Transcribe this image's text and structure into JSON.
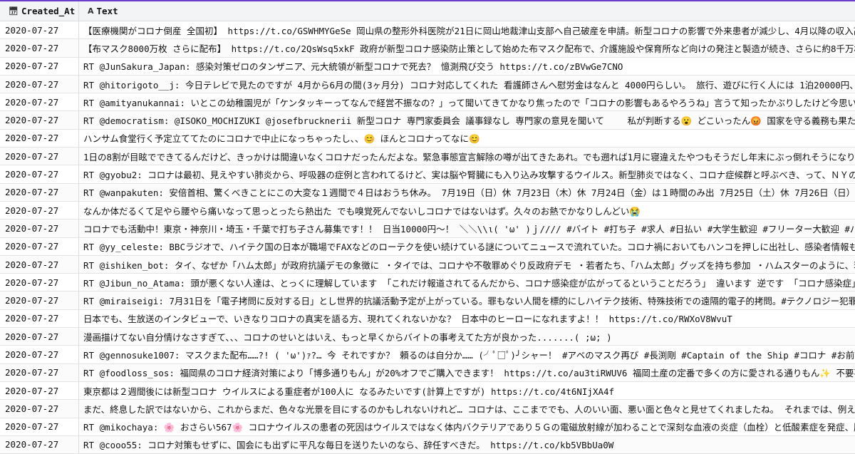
{
  "columns": [
    {
      "label": "Created_At",
      "icon": "calendar-icon"
    },
    {
      "label": "Text",
      "icon": "text-type-icon"
    }
  ],
  "rows": [
    {
      "date": "2020-07-27",
      "text": "【医療機関がコロナ倒産 全国初】 https://t.co/GSWHMYGeSe 岡山県の整形外科医院が21日に岡山地裁津山支部へ自己破産を申請。新型コロナの影響で外来患者が減少し、4月以降の収入高は前年同"
    },
    {
      "date": "2020-07-27",
      "text": "【布マスク8000万枚 さらに配布】 https://t.co/2QsWsq5xkF 政府が新型コロナ感染防止策として始めた布マスク配布で、介護施設や保育所など向けの発注と製造が続き、さらに約8千万枚を配る計画"
    },
    {
      "date": "2020-07-27",
      "text": "RT @JunSakura_Japan: 感染対策ゼロのタンザニア、元大統領が新型コロナで死去？ 憶測飛び交う https://t.co/zBVwGe7CNO"
    },
    {
      "date": "2020-07-27",
      "text": "RT @hitorigoto__j: 今日テレビで見たのですが 4月から6月の間(3ヶ月分) コロナ対応してくれた 看護師さんへ慰労金はなんと 4000円らしい。 旅行、遊びに行く人には 1泊20000円、日帰り1万"
    },
    {
      "date": "2020-07-27",
      "text": "RT @amityanukannai: いとこの幼稚園児が「ケンタッキーってなんで経営不振なの？」って聞いてきてかなり焦ったので「コロナの影響もあるやろうね」言うて知ったかぶりしたけど今思い返せば"
    },
    {
      "date": "2020-07-27",
      "text": "RT @democratism: @ISOKO_MOCHIZUKI @josefbrucknerii 新型コロナ 専門家委員会 議事録なし 専門家の意見を聞いて 　　私が判断する😮 どこいったん😡 国家を守る義務も果たさん奴は"
    },
    {
      "date": "2020-07-27",
      "text": "ハンサム食堂行く予定立ててたのにコロナで中止になっちゃったし、、😊 ほんとコロナってなに😊"
    },
    {
      "date": "2020-07-27",
      "text": "1日の8割が目眩でできてるんだけど、きっかけは間違いなくコロナだったんだよな。緊急事態宣言解除の噂が出てきたあれ。でも遡れば1月に寝違えたやつもそうだし年末にぶっ倒れそうになりながら生"
    },
    {
      "date": "2020-07-27",
      "text": "RT @gyobu2: コロナは最初、見えやすい肺炎から、呼吸器の症例と言われてるけど、実は脳や腎臓にも入り込み攻撃するウイルス。新型肺炎ではなく、コロナ症候群と呼ぶべき、って、ＮＹの医師が。"
    },
    {
      "date": "2020-07-27",
      "text": "RT @wanpakuten: 安倍首相、驚くべきことにこの大変な１週間で４日はおうち休み。 7月19日（日）休 7月23日（木）休 7月24日（金）は１時間のみ出 7月25日（土）休 7月26日（日）休 「全力"
    },
    {
      "date": "2020-07-27",
      "text": "なんか体だるくて足やら腰やら痛いなって思っとったら熱出た でも嗅覚死んでないしコロナではないはず。久々のお熱でかなりしんどい😭"
    },
    {
      "date": "2020-07-27",
      "text": "コロナでも活動中！東京・神奈川・埼玉・千葉で打ち子さん募集です！！ 日当10000円〜！ ＼＼\\\\ι( 'ω' )ｊ//// #バイト #打ち子 #求人 #日払い #大学生歓迎 #フリーター大歓迎 #パ"
    },
    {
      "date": "2020-07-27",
      "text": "RT @yy_celeste: BBCラジオで、ハイテク国の日本が職場でFAXなどのローテクを使い続けている謎についてニュースで流れていた。コロナ禍においてもハンコを押しに出社し、感染者情報も手書きで"
    },
    {
      "date": "2020-07-27",
      "text": "RT @ishiken_bot: タイ、なぜか「ハム太郎」が政府抗議デモの象徴に ・タイでは、コロナや不敬罪めぐり反政府デモ ・若者たち、「ハム太郎」グッズを持ち参加 ・ハムスターのように、若者たち"
    },
    {
      "date": "2020-07-27",
      "text": "RT @Jibun_no_Atama: 頭が悪くない人達は、とっくに理解しています 「これだけ報道されてるんだから、コロナ感染症が広がってるということだろう」 違います 逆です 「コロナ感染症」を広げた"
    },
    {
      "date": "2020-07-27",
      "text": "RT @miraiseigi: 7月31日を「電子拷問に反対する日」とし世界的抗議活動予定が上がっている。罪もない人間を標的にしハイテク技術、特殊技術での遠隔的電子的拷問。#テクノロジー犯罪 エレクト"
    },
    {
      "date": "2020-07-27",
      "text": "日本でも、生放送のインタビューで、いきなりコロナの真実を語る方、現れてくれないかな？ 日本中のヒーローになれますよ！！ https://t.co/RWXoV8WvuT"
    },
    {
      "date": "2020-07-27",
      "text": "漫画描けてない自分情けなさすぎて、、、コロナのせいとはいえ、もっと早くからバイトの事考えてた方が良かった.......( ;ω; )"
    },
    {
      "date": "2020-07-27",
      "text": "RT @gennosuke1007: マスクまた配布……?! ( 'ω')ｧ?… 今 それですか？ 頼るのは自分か…… (╯ﾟ□ﾟ)╯シャー！ #アベのマスク再び #長渕剛 #Captain of the Ship #コロナ #お前が舵を取れ"
    },
    {
      "date": "2020-07-27",
      "text": "RT @foodloss_sos: 福岡県のコロナ経済対策により「博多通りもん」が20%オフでご購入できます！ https://t.co/au3tiRWUV6 福岡土産の定番で多くの方に愛される通りもん✨ 不要不急の外出"
    },
    {
      "date": "2020-07-27",
      "text": "東京都は２週間後には新型コロナ ウイルスによる重症者が100人に なるみたいです(計算上ですが) https://t.co/4t6NIjXA4f"
    },
    {
      "date": "2020-07-27",
      "text": "まだ、終息した訳ではないから、これからまだ、色々な光景を目にするのかもしれないけれど… コロナは、ここまででも、人のいい面、悪い面と色々と見せてくれましたね。 それまでは、例えば、煽り"
    },
    {
      "date": "2020-07-27",
      "text": "RT @mikochaya: 🌸 おさらい567🌸 コロナウイルスの患者の死因はウイルスではなく体内バクテリアであり５Ｇの電磁放射線が加わることで深刻な血液の炎症（血栓）と低酸素症を発症、肺炎に似た"
    },
    {
      "date": "2020-07-27",
      "text": "RT @cooo55: コロナ対策もせずに、国会にも出ずに平凡な毎日を送りたいのなら、辞任すべきだ。 https://t.co/kb5VBbUa0W"
    }
  ]
}
